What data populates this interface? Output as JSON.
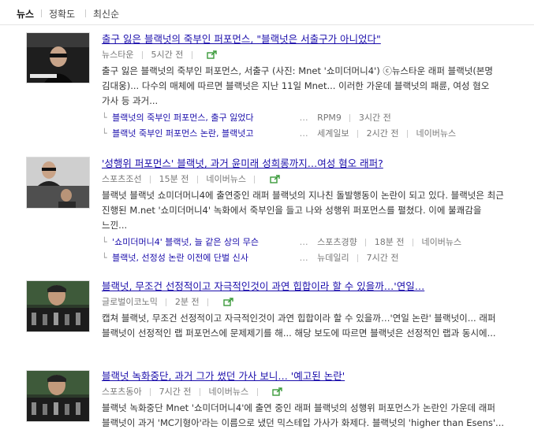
{
  "tabs": [
    {
      "label": "뉴스"
    },
    {
      "label": "정확도"
    },
    {
      "label": "최신순"
    }
  ],
  "articles": [
    {
      "title": "출구 잃은 블랙넛의 죽부인 퍼포먼스, \"블랙넛은 서출구가 아니었다\"",
      "source": "뉴스타운",
      "time": "5시간 전",
      "summary": "출구 잃은 블랙넛의 죽부인 퍼포먼스, 서출구 (사진: Mnet '쇼미더머니4') ⓒ뉴스타운 래퍼 블랙넛(본명 김대웅)... 다수의 매체에 따르면 블랙넛은 지난 11일 Mnet... 이러한 가운데 블랙넛의 패륜, 여성 혐오 가사 등 과거...",
      "related": [
        {
          "title": "블랙넛의 죽부인 퍼포먼스, 출구 잃었다",
          "source": "RPM9",
          "time": "3시간 전"
        },
        {
          "title": "블랙넛 죽부인 퍼포먼스 논란, 블랙넛고",
          "source": "세계일보",
          "time": "2시간 전",
          "portal": "네이버뉴스"
        }
      ]
    },
    {
      "title": "'성행위 퍼포먼스' 블랙넛, 과거 윤미래 성희롱까지…여성 혐오 래퍼?",
      "source": "스포츠조선",
      "time": "15분 전",
      "portal": "네이버뉴스",
      "summary": "블랙넛 블랙넛 쇼미더머니4에 출연중인 래퍼 블랙넛의 지나친 돌발행동이 논란이 되고 있다. 블랙넛은 최근 진행된 M.net '쇼미더머니4' 녹화에서 죽부인을 들고 나와 성행위 퍼포먼스를 펼쳤다. 이에 불쾌감을 느낀...",
      "related": [
        {
          "title": "'쇼미더머니4' 블랙넛, 늘 같은 상의 무슨",
          "source": "스포츠경향",
          "time": "18분 전",
          "portal": "네이버뉴스"
        },
        {
          "title": "블랙넛, 선정성 논란 이전에 단벌 신사",
          "source": "뉴데일리",
          "time": "7시간 전"
        }
      ]
    },
    {
      "title": "블랙넛, 무조건 선정적이고 자극적인것이 과연 힙합이라 할 수 있을까…'연일…",
      "source": "글로벌이코노믹",
      "time": "2분 전",
      "summary": "캡쳐 블랙넛, 무조건 선정적이고 자극적인것이 과연 힙합이라 할 수 있을까…'연일 논란' 블랙넛이... 래퍼 블랙넛이 선정적인 랩 퍼포먼스에 문제제기를 해... 해당 보도에 따르면 블랙넛은 선정적인 랩과 동시에...",
      "related": []
    },
    {
      "title": "블랙넛 녹화중단, 과거 그가 썼던 가사 보니… '예고된 논란'",
      "source": "스포츠동아",
      "time": "7시간 전",
      "portal": "네이버뉴스",
      "summary": "블랙넛 녹화중단 Mnet '쇼미더머니4'에 출연 중인 래퍼 블랙넛의 성행위 퍼포먼스가 논란인 가운데 래퍼 블랙넛이 과거 'MC기형아'라는 이름으로 냈던 믹스테입 가사가 화제다. 블랙넛의 'higher than Esens'...",
      "related": []
    }
  ],
  "colors": {
    "link": "#1a0dab",
    "meta": "#777777",
    "share_icon": "#3a9a3a"
  },
  "icons": {
    "share": "external-share-icon"
  }
}
